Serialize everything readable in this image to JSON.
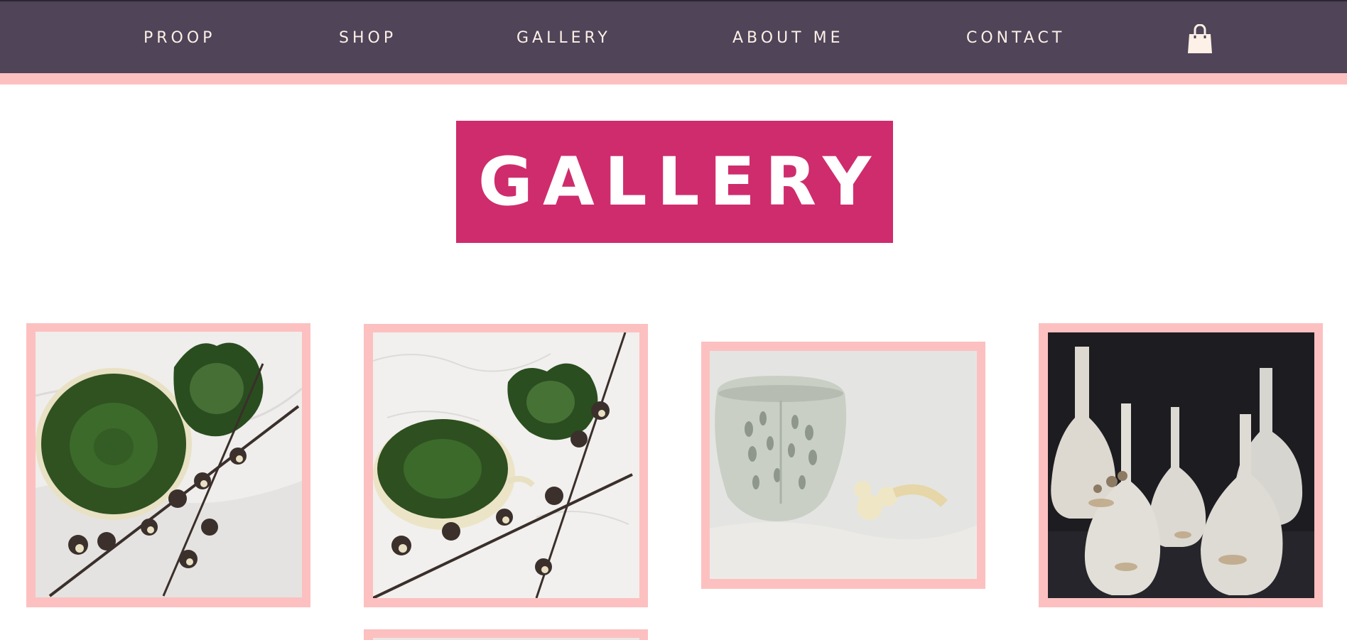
{
  "nav": {
    "items": [
      {
        "label": "PROOP"
      },
      {
        "label": "SHOP"
      },
      {
        "label": "GALLERY"
      },
      {
        "label": "ABOUT ME"
      },
      {
        "label": "CONTACT"
      }
    ],
    "cart_icon": "shopping-bag-icon"
  },
  "page": {
    "title": "GALLERY"
  },
  "gallery": {
    "items": [
      {
        "subject": "two green glazed bowls with dried cotton branches"
      },
      {
        "subject": "green bowls on white lace with dried cotton branches"
      },
      {
        "subject": "white pierced ceramic candle holder"
      },
      {
        "subject": "white glazed bud vases on dark background"
      },
      {
        "subject": "partially visible gallery image"
      }
    ]
  },
  "colors": {
    "nav_background": "#4f4458",
    "nav_text": "#fdf0e6",
    "accent_pink": "#fdc0c0",
    "title_background": "#cf2c6d",
    "title_text": "#ffffff"
  }
}
